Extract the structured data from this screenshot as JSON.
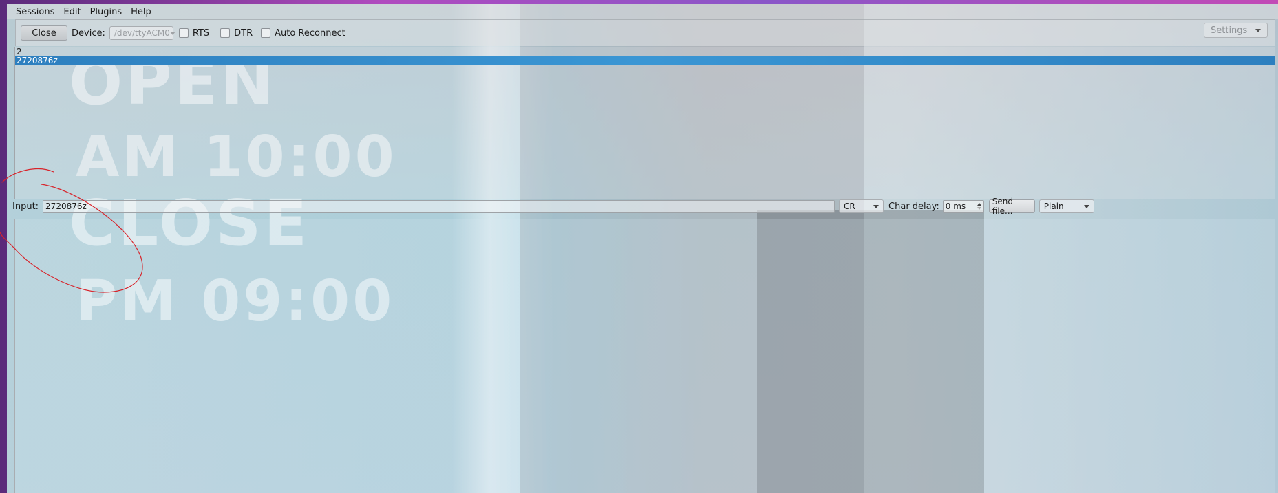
{
  "menubar": {
    "items": [
      "Sessions",
      "Edit",
      "Plugins",
      "Help"
    ]
  },
  "toolbar": {
    "close_label": "Close",
    "device_label": "Device:",
    "device_value": "/dev/ttyACM0",
    "rts_label": "RTS",
    "rts_checked": false,
    "dtr_label": "DTR",
    "dtr_checked": false,
    "auto_reconnect_label": "Auto Reconnect",
    "auto_reconnect_checked": false,
    "settings_label": "Settings"
  },
  "output": {
    "lines": [
      "2",
      "2720876z"
    ],
    "selected_line": "2720876z"
  },
  "input_row": {
    "input_label": "Input:",
    "input_value": "2720876z",
    "line_ending": "CR",
    "char_delay_label": "Char delay:",
    "char_delay_value": "0 ms",
    "send_file_label": "Send file...",
    "mode": "Plain"
  },
  "background": {
    "text_lines": [
      "OPEN",
      "AM 10:00",
      "CLOSE",
      "PM 09:00"
    ]
  },
  "colors": {
    "selection": "#3a96d4",
    "annotation": "#d8232a"
  }
}
